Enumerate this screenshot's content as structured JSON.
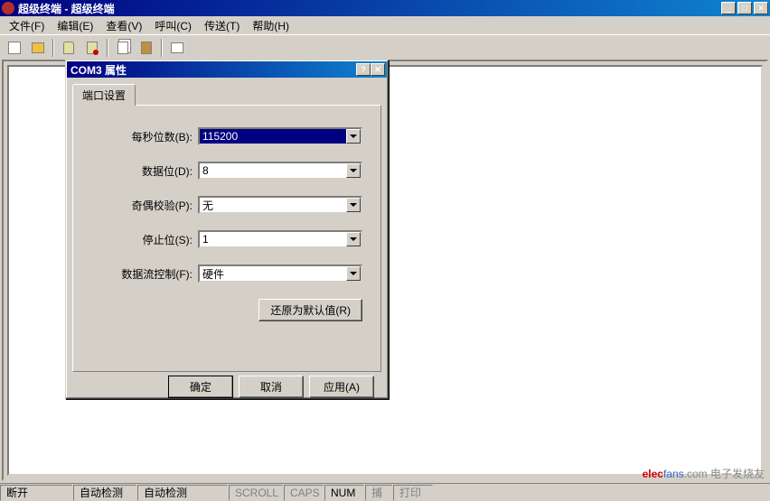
{
  "window": {
    "title": "超级终端 - 超级终端"
  },
  "menu": {
    "file": "文件(F)",
    "edit": "编辑(E)",
    "view": "查看(V)",
    "call": "呼叫(C)",
    "transfer": "传送(T)",
    "help": "帮助(H)"
  },
  "dialog": {
    "title": "COM3 属性",
    "tab": "端口设置",
    "fields": {
      "baud_label": "每秒位数(B):",
      "baud_value": "115200",
      "databits_label": "数据位(D):",
      "databits_value": "8",
      "parity_label": "奇偶校验(P):",
      "parity_value": "无",
      "stopbits_label": "停止位(S):",
      "stopbits_value": "1",
      "flow_label": "数据流控制(F):",
      "flow_value": "硬件"
    },
    "restore_btn": "还原为默认值(R)",
    "ok_btn": "确定",
    "cancel_btn": "取消",
    "apply_btn": "应用(A)"
  },
  "status": {
    "conn": "断开",
    "detect1": "自动检测",
    "detect2": "自动检测",
    "scroll": "SCROLL",
    "caps": "CAPS",
    "num": "NUM",
    "capture": "捕",
    "print": "打印"
  },
  "watermark": {
    "brand_red": "elec",
    "brand_blue": "fans",
    "suffix": ".com 电子发烧友"
  }
}
